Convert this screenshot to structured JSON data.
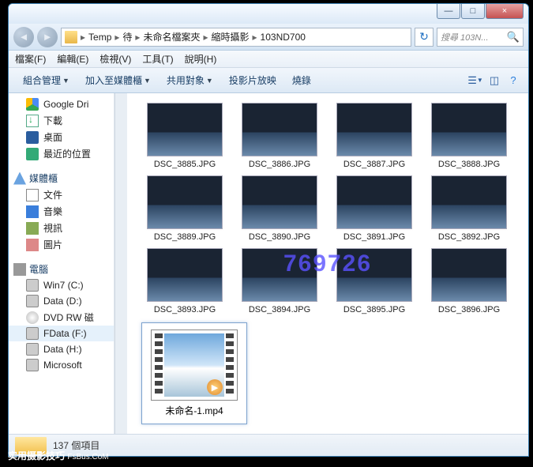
{
  "window": {
    "min": "—",
    "max": "□",
    "close": "×"
  },
  "breadcrumbs": [
    "Temp",
    "待",
    "未命名檔案夾",
    "縮時攝影",
    "103ND700"
  ],
  "search": {
    "placeholder": "搜尋 103N..."
  },
  "menubar": {
    "file": "檔案(F)",
    "edit": "編輯(E)",
    "view": "檢視(V)",
    "tools": "工具(T)",
    "help": "說明(H)"
  },
  "toolbar": {
    "organize": "組合管理",
    "include": "加入至媒體櫃",
    "share": "共用對象",
    "slideshow": "投影片放映",
    "burn": "燒錄"
  },
  "sidebar": {
    "fav_items": [
      {
        "icon": "gdrive",
        "label": "Google Dri"
      },
      {
        "icon": "down",
        "label": "下載"
      },
      {
        "icon": "desk",
        "label": "桌面"
      },
      {
        "icon": "recent",
        "label": "最近的位置"
      }
    ],
    "lib_header": "媒體櫃",
    "lib_items": [
      {
        "icon": "doc",
        "label": "文件"
      },
      {
        "icon": "music",
        "label": "音樂"
      },
      {
        "icon": "video",
        "label": "視訊"
      },
      {
        "icon": "pic",
        "label": "圖片"
      }
    ],
    "pc_header": "電腦",
    "pc_items": [
      {
        "icon": "drive",
        "label": "Win7 (C:)"
      },
      {
        "icon": "drive",
        "label": "Data (D:)"
      },
      {
        "icon": "dvd",
        "label": "DVD RW 磁"
      },
      {
        "icon": "drive",
        "label": "FData (F:)"
      },
      {
        "icon": "drive",
        "label": "Data (H:)"
      },
      {
        "icon": "drive",
        "label": "Microsoft"
      }
    ]
  },
  "files": [
    "DSC_3885.JPG",
    "DSC_3886.JPG",
    "DSC_3887.JPG",
    "DSC_3888.JPG",
    "DSC_3889.JPG",
    "DSC_3890.JPG",
    "DSC_3891.JPG",
    "DSC_3892.JPG",
    "DSC_3893.JPG",
    "DSC_3894.JPG",
    "DSC_3895.JPG",
    "DSC_3896.JPG"
  ],
  "selected_file": "未命名-1.mp4",
  "status": {
    "count": "137 個項目"
  },
  "watermark": "769726",
  "badge": {
    "l1": "实用摄影技巧",
    "l2": "FsBus.CoM"
  }
}
